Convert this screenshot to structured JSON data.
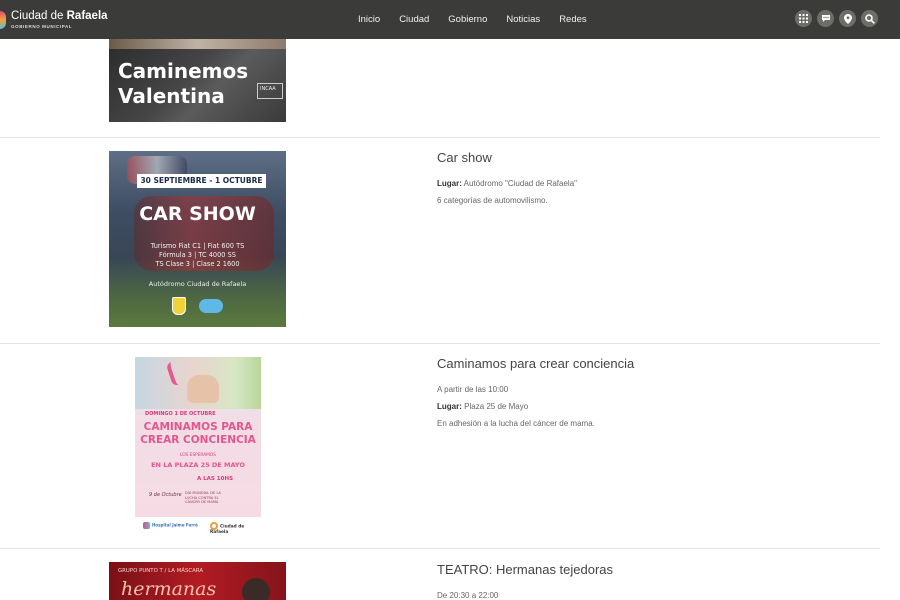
{
  "header": {
    "logo": {
      "title_pre": "Ciudad de ",
      "title_bold": "Rafaela",
      "subtitle": "GOBIERNO MUNICIPAL"
    },
    "nav": [
      "Inicio",
      "Ciudad",
      "Gobierno",
      "Noticias",
      "Redes"
    ],
    "icons": [
      "grid-icon",
      "chat-icon",
      "location-pin-icon",
      "search-icon"
    ]
  },
  "events": [
    {
      "image_text": {
        "line1": "Caminemos",
        "line2": "Valentina",
        "badge": "INCAA"
      }
    },
    {
      "title": "Car show",
      "lugar_label": "Lugar:",
      "lugar_value": "Autódromo \"Ciudad de Rafaela\"",
      "desc": "6 categorías de automovilismo.",
      "image_text": {
        "date": "30 SEPTIEMBRE - 1 OCTUBRE",
        "headline": "CAR SHOW",
        "cat1": "Turismo Fiat C1  |  Fiat 600 TS",
        "cat2": "Fórmula 3  |  TC 4000 SS",
        "cat3": "TS Clase 3  |  Clase 2 1600",
        "place": "Autódromo Ciudad de Rafaela"
      }
    },
    {
      "title": "Caminamos para crear conciencia",
      "time": "A partir de las 10:00",
      "lugar_label": "Lugar:",
      "lugar_value": "Plaza 25 de Mayo",
      "desc": "En adhesión a la lucha del cáncer de mama.",
      "image_text": {
        "date": "DOMINGO 1 DE OCTUBRE",
        "headline1": "CAMINAMOS PARA",
        "headline2": "CREAR CONCIENCIA",
        "sub": "LOS ESPERAMOS",
        "place": "EN LA PLAZA 25 DE MAYO",
        "hour": "A LAS 10HS",
        "sign": "9 de Octubre",
        "note": "DÍA MUNDIAL DE LA LUCHA CONTRA EL CÁNCER DE MAMA",
        "logo1": "Hospital Jaime Ferré",
        "logo2": "Ciudad de Rafaela"
      }
    },
    {
      "title": "TEATRO: Hermanas tejedoras",
      "time": "De 20:30 a 22:00",
      "image_text": {
        "top": "GRUPO PUNTO T / LA MÁSCARA",
        "headline": "hermanas"
      }
    }
  ],
  "colors": {
    "header_bg": "#3b3b39",
    "accent_pink": "#e2568f"
  }
}
